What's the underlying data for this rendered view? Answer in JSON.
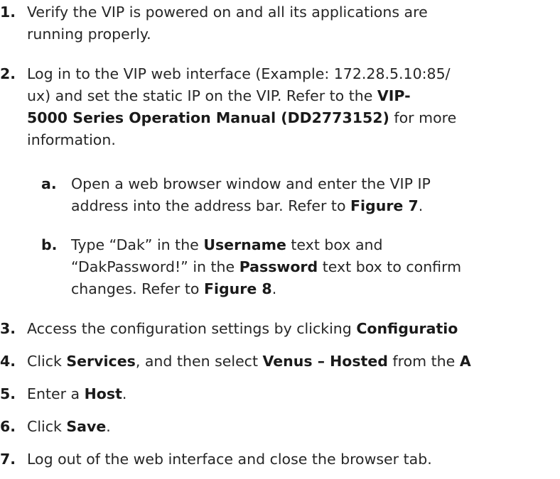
{
  "steps": [
    {
      "number": "1.",
      "lines": [
        [
          "Verify the VIP is powered on and all its applications are"
        ],
        [
          "running properly."
        ]
      ]
    },
    {
      "number": "2.",
      "lines": [
        [
          "Log in to the VIP web interface (Example: 172.28.5.10:85/"
        ],
        [
          "ux) and set the static IP on the VIP. Refer to the ",
          {
            "b": "VIP-"
          }
        ],
        [
          {
            "b": "5000 Series Operation Manual (DD2773152)"
          },
          " for more"
        ],
        [
          "information."
        ]
      ]
    },
    {
      "number": "a.",
      "sub": true,
      "lines": [
        [
          "Open a web browser window and enter the VIP IP"
        ],
        [
          "address into the address bar. Refer to ",
          {
            "b": "Figure 7"
          },
          "."
        ]
      ]
    },
    {
      "number": "b.",
      "sub": true,
      "lines": [
        [
          "Type “Dak” in the ",
          {
            "b": "Username"
          },
          " text box and"
        ],
        [
          "“DakPassword!” in the ",
          {
            "b": "Password"
          },
          " text box to confirm"
        ],
        [
          "changes. Refer to ",
          {
            "b": "Figure 8"
          },
          "."
        ]
      ]
    },
    {
      "number": "3.",
      "lines": [
        [
          "Access the configuration settings by clicking ",
          {
            "b": "Configuratio"
          }
        ]
      ]
    },
    {
      "number": "4.",
      "lines": [
        [
          "Click ",
          {
            "b": "Services"
          },
          ", and then select ",
          {
            "b": "Venus – Hosted"
          },
          " from the ",
          {
            "b": "A"
          }
        ]
      ]
    },
    {
      "number": "5.",
      "lines": [
        [
          "Enter a ",
          {
            "b": "Host"
          },
          "."
        ]
      ]
    },
    {
      "number": "6.",
      "lines": [
        [
          "Click ",
          {
            "b": "Save"
          },
          "."
        ]
      ]
    },
    {
      "number": "7.",
      "lines": [
        [
          "Log out of the web interface and close the browser tab."
        ]
      ]
    }
  ]
}
